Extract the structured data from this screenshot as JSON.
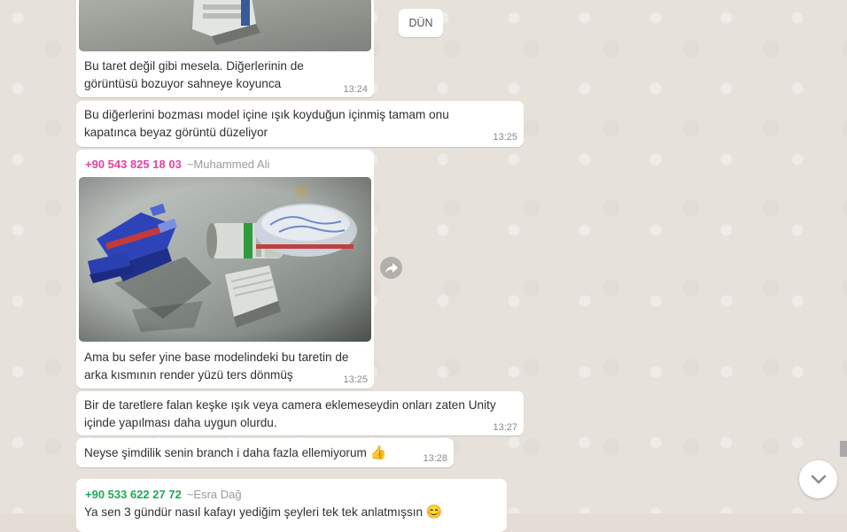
{
  "date_divider": "DÜN",
  "messages": [
    {
      "text": "Bu taret değil gibi mesela. Diğerlerinin de görüntüsü bozuyor sahneye koyunca",
      "time": "13:24"
    },
    {
      "text": "Bu diğerlerini bozması model içine ışık koyduğun içinmiş tamam onu kapatınca beyaz görüntü düzeliyor",
      "time": "13:25"
    },
    {
      "sender_phone": "+90 543 825 18 03",
      "sender_name": "~Muhammed Ali",
      "sender_color": "#e542a3",
      "text": "Ama bu sefer yine base modelindeki bu taretin de arka kısmının render yüzü ters dönmüş",
      "time": "13:25"
    },
    {
      "text": "Bir de taretlere falan keşke ışık veya camera eklemeseydin onları zaten Unity içinde yapılması daha uygun olurdu.",
      "time": "13:27"
    },
    {
      "text": "Neyse şimdilik senin branch i daha fazla ellemiyorum",
      "emoji": "👍",
      "time": "13:28"
    },
    {
      "sender_phone": "+90 533 622 27 72",
      "sender_name": "~Esra Dağ",
      "sender_color": "#1fa855",
      "text": "Ya sen 3 gündür nasıl kafayı yediğim şeyleri tek tek anlatmışsın",
      "emoji": "😊"
    }
  ],
  "icons": {
    "forward": "forward-arrow-icon",
    "scroll_down": "chevron-down-icon"
  }
}
